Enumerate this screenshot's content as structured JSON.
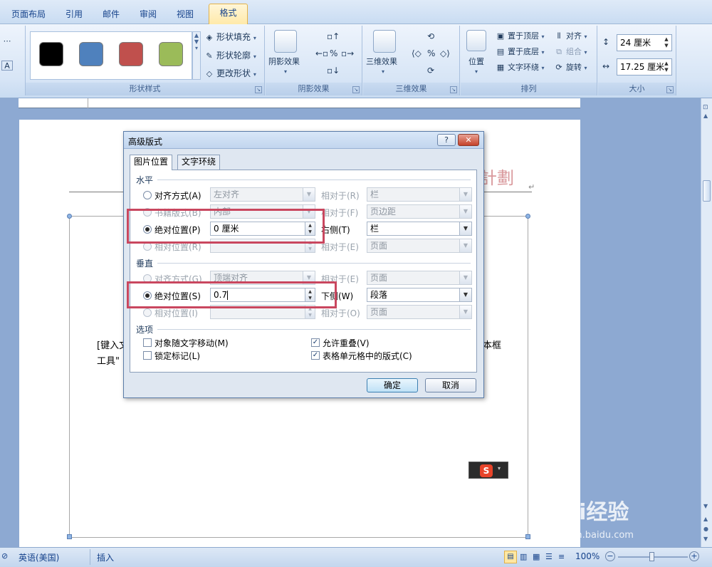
{
  "tabs": [
    "页面布局",
    "引用",
    "邮件",
    "审阅",
    "视图",
    "格式"
  ],
  "active_tab": "格式",
  "ribbon": {
    "shape_styles": {
      "label": "形状样式",
      "swatch_colors": [
        "#000000",
        "#4f81bd",
        "#c0504d",
        "#9bbb59"
      ],
      "fill": "形状填充",
      "outline": "形状轮廓",
      "change_shape": "更改形状"
    },
    "shadow": {
      "label": "阴影效果",
      "button": "阴影效果"
    },
    "three_d": {
      "label": "三维效果",
      "button": "三维效果"
    },
    "arrange": {
      "label": "排列",
      "position": "位置",
      "bring_front": "置于顶层",
      "send_back": "置于底层",
      "text_wrap": "文字环绕",
      "align": "对齐",
      "group": "组合",
      "rotate": "旋转"
    },
    "size": {
      "label": "大小",
      "height": "24 厘米",
      "width": "17.25 厘米"
    }
  },
  "document": {
    "body_text_1": "[键入文",
    "body_text_2": "工具\"",
    "body_text_right": "本框",
    "logo_text": "計劃"
  },
  "dialog": {
    "title": "高级版式",
    "help_button": "?",
    "close_button": "✕",
    "tabs": [
      "图片位置",
      "文字环绕"
    ],
    "horizontal": {
      "section": "水平",
      "align_label": "对齐方式(A)",
      "align_value": "左对齐",
      "align_rel_label": "相对于(R)",
      "align_rel_value": "栏",
      "book_label": "书籍版式(B)",
      "book_value": "内部",
      "book_rel_label": "相对于(F)",
      "book_rel_value": "页边距",
      "abs_label": "绝对位置(P)",
      "abs_value": "0 厘米",
      "abs_side_label": "右侧(T)",
      "abs_side_value": "栏",
      "rel_label": "相对位置(R)",
      "rel_value": "",
      "rel_rel_label": "相对于(E)",
      "rel_rel_value": "页面"
    },
    "vertical": {
      "section": "垂直",
      "align_label": "对齐方式(G)",
      "align_value": "顶端对齐",
      "align_rel_label": "相对于(E)",
      "align_rel_value": "页面",
      "abs_label": "绝对位置(S)",
      "abs_value": "0.7",
      "abs_below_label": "下侧(W)",
      "abs_below_value": "段落",
      "rel_label": "相对位置(I)",
      "rel_value": "",
      "rel_rel_label": "相对于(O)",
      "rel_rel_value": "页面"
    },
    "options": {
      "section": "选项",
      "move_with_text": "对象随文字移动(M)",
      "lock_anchor": "锁定标记(L)",
      "allow_overlap": "允许重叠(V)",
      "layout_in_cell": "表格单元格中的版式(C)",
      "move_with_text_checked": false,
      "lock_anchor_checked": false,
      "allow_overlap_checked": true,
      "layout_in_cell_checked": true
    },
    "ok": "确定",
    "cancel": "取消"
  },
  "statusbar": {
    "language": "英语(美国)",
    "mode": "插入",
    "zoom": "100%"
  },
  "watermark": {
    "brand": "Bai经验",
    "url": "jingyan.baidu.com"
  }
}
